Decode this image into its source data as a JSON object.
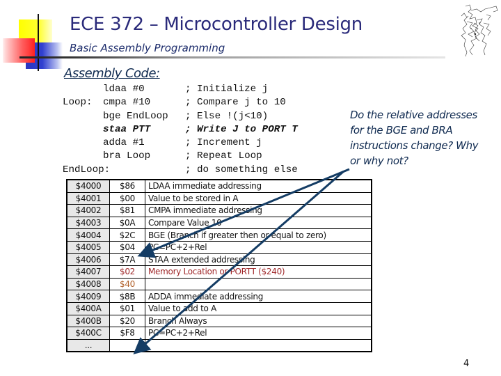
{
  "slide": {
    "title": "ECE 372 – Microcontroller Design",
    "subtitle": "Basic Assembly Programming",
    "page_number": "4",
    "clipart_icon": "sketch-figure-icon"
  },
  "code_section": {
    "heading": "Assembly Code:",
    "lines": [
      {
        "label": "",
        "instr": "ldaa #0",
        "comment": "; Initialize j",
        "emphasis": false
      },
      {
        "label": "Loop:",
        "instr": "cmpa #10",
        "comment": "; Compare j to 10",
        "emphasis": false
      },
      {
        "label": "",
        "instr": "bge EndLoop",
        "comment": "; Else !(j<10)",
        "emphasis": false
      },
      {
        "label": "",
        "instr": "staa PTT",
        "comment": "; Write J to PORT T",
        "emphasis": true
      },
      {
        "label": "",
        "instr": "adda #1",
        "comment": "; Increment j",
        "emphasis": false
      },
      {
        "label": "",
        "instr": "bra Loop",
        "comment": "; Repeat Loop",
        "emphasis": false
      },
      {
        "label": "EndLoop:",
        "instr": "",
        "comment": "; do something else",
        "emphasis": false
      }
    ]
  },
  "question": "Do the relative addresses for the BGE and BRA instructions change? Why or why not?",
  "memory_table": {
    "rows": [
      {
        "addr": "$4000",
        "val": "$86",
        "desc": "LDAA immediate addressing",
        "color": ""
      },
      {
        "addr": "$4001",
        "val": "$00",
        "desc": "Value to be stored in A",
        "color": ""
      },
      {
        "addr": "$4002",
        "val": "$81",
        "desc": "CMPA immediate addressing",
        "color": ""
      },
      {
        "addr": "$4003",
        "val": "$0A",
        "desc": "Compare Value 10",
        "color": ""
      },
      {
        "addr": "$4004",
        "val": "$2C",
        "desc": "BGE (Branch if greater then or equal to zero)",
        "color": ""
      },
      {
        "addr": "$4005",
        "val": "$04",
        "desc": "PC=PC+2+Rel",
        "color": ""
      },
      {
        "addr": "$4006",
        "val": "$7A",
        "desc": "STAA extended addressing",
        "color": ""
      },
      {
        "addr": "$4007",
        "val": "$02",
        "desc": "Memory Location or PORTT ($240)",
        "color": "red"
      },
      {
        "addr": "$4008",
        "val": "$40",
        "desc": "",
        "color": "orange"
      },
      {
        "addr": "$4009",
        "val": "$8B",
        "desc": "ADDA immediate addressing",
        "color": ""
      },
      {
        "addr": "$400A",
        "val": "$01",
        "desc": "Value to add to A",
        "color": ""
      },
      {
        "addr": "$400B",
        "val": "$20",
        "desc": "Branch Always",
        "color": ""
      },
      {
        "addr": "$400C",
        "val": "$F8",
        "desc": "PC=PC+2+Rel",
        "color": ""
      },
      {
        "addr": "...",
        "val": "",
        "desc": "",
        "color": ""
      }
    ]
  },
  "colors": {
    "title": "#2a2a7a",
    "heading": "#0f2a50",
    "arrow": "#143c64",
    "highlight_red": "#a0282a",
    "highlight_orange": "#b0602a",
    "address_cell_bg": "#e8e8e8"
  },
  "annotations": {
    "arrows": [
      {
        "from": "question",
        "to_row": "$4005"
      },
      {
        "from": "question",
        "to_row": "$400C"
      }
    ]
  }
}
